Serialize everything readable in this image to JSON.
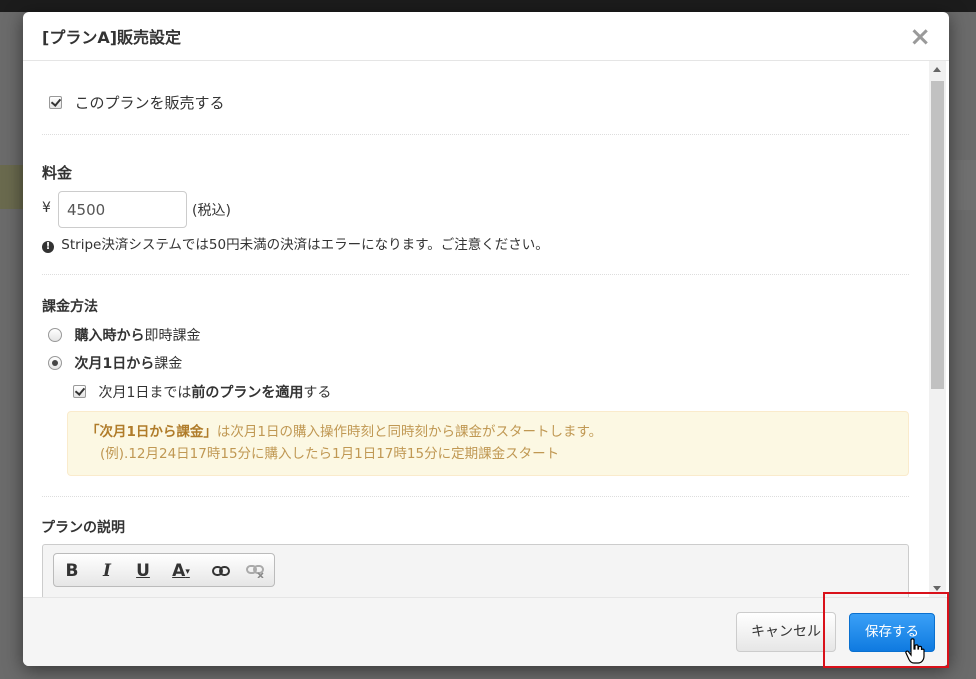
{
  "modal": {
    "title": "[プランA]販売設定",
    "close_label": "×"
  },
  "sell_checkbox": {
    "label": "このプランを販売する",
    "checked": true
  },
  "price": {
    "heading": "料金",
    "currency": "¥",
    "value": "4500",
    "suffix": "(税込)",
    "warning": "Stripe決済システムでは50円未満の決済はエラーになります。ご注意ください。"
  },
  "billing": {
    "heading": "課金方法",
    "options": [
      {
        "label_bold": "購入時から",
        "label_rest": "即時課金",
        "checked": false
      },
      {
        "label_bold": "次月1日から",
        "label_rest": "課金",
        "checked": true
      }
    ],
    "sub_checkbox": {
      "prefix": "次月1日までは",
      "bold": "前のプランを適用",
      "suffix": "する",
      "checked": true
    },
    "notice": {
      "line1_strong": "「次月1日から課金」",
      "line1_rest": "は次月1日の購入操作時刻と同時刻から課金がスタートします。",
      "line2": "(例).12月24日17時15分に購入したら1月1日17時15分に定期課金スタート"
    }
  },
  "description": {
    "heading": "プランの説明",
    "toolbar": [
      {
        "name": "bold-icon",
        "glyph": "B"
      },
      {
        "name": "italic-icon",
        "glyph": "I"
      },
      {
        "name": "underline-icon",
        "glyph": "U"
      },
      {
        "name": "font-color-icon",
        "glyph": "A"
      },
      {
        "name": "link-icon",
        "glyph": "🔗"
      },
      {
        "name": "unlink-icon",
        "glyph": "⛓"
      }
    ]
  },
  "footer": {
    "cancel_label": "キャンセル",
    "save_label": "保存する"
  },
  "colors": {
    "primary": "#1a84ea",
    "highlight": "#d9111a",
    "notice_bg": "#fcf8e3",
    "notice_text": "#c09853"
  }
}
